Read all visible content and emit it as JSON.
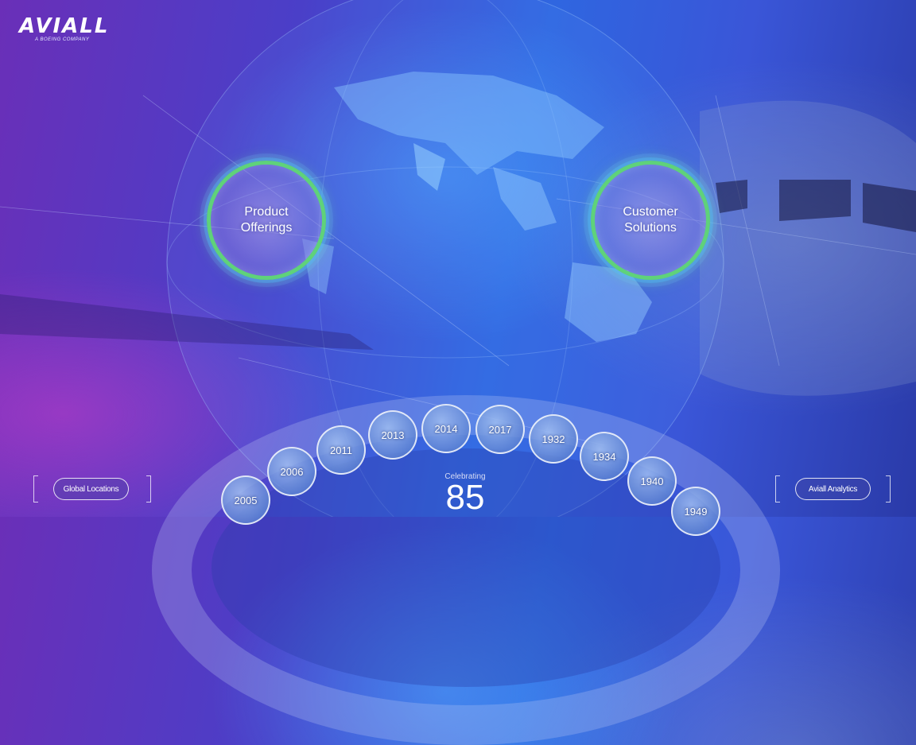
{
  "brand": {
    "name": "AVIALL",
    "tagline": "A BOEING COMPANY"
  },
  "nav": {
    "product_offerings": "Product Offerings",
    "customer_solutions": "Customer Solutions"
  },
  "anniversary": {
    "label": "Celebrating",
    "years": "85"
  },
  "timeline": [
    "2005",
    "2006",
    "2011",
    "2013",
    "2014",
    "2017",
    "1932",
    "1934",
    "1940",
    "1949"
  ],
  "buttons": {
    "global_locations": "Global Locations",
    "analytics": "Aviall Analytics"
  },
  "colors": {
    "ring_green": "#5fd27a",
    "accent_blue": "#2f66e0",
    "accent_purple": "#6a2fb8"
  }
}
